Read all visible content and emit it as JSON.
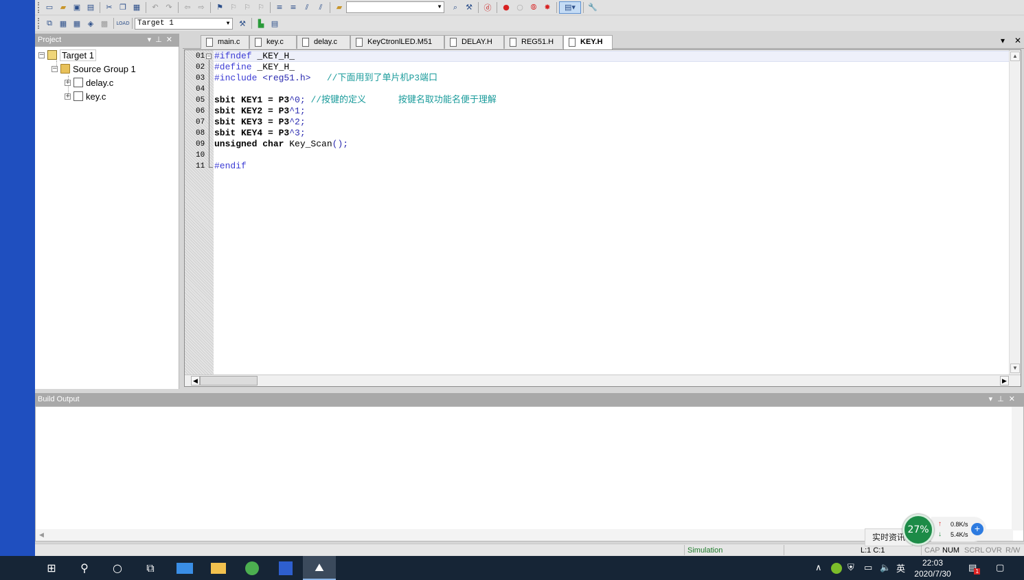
{
  "toolbar": {
    "target_combo": "Target 1",
    "find_combo": ""
  },
  "project": {
    "title": "Project",
    "target": "Target 1",
    "group": "Source Group 1",
    "files": [
      "delay.c",
      "key.c"
    ]
  },
  "tabs": [
    "main.c",
    "key.c",
    "delay.c",
    "KeyCtronlLED.M51",
    "DELAY.H",
    "REG51.H",
    "KEY.H"
  ],
  "active_tab": "KEY.H",
  "code": {
    "line_numbers": [
      "01",
      "02",
      "03",
      "04",
      "05",
      "06",
      "07",
      "08",
      "09",
      "10",
      "11"
    ],
    "l1_pre": "#ifndef",
    "l1_rest": " _KEY_H_",
    "l2_pre": "#define",
    "l2_rest": " _KEY_H_",
    "l3_pre": "#include",
    "l3_str": " <reg51.h>",
    "l3_cmt": "   //下面用到了单片机P3端口",
    "l5_a": "sbit KEY1 = P3",
    "l5_b": "^0",
    "l5_c": ";",
    "l5_cmt": " //按键的定义      按键名取功能名便于理解",
    "l6_a": "sbit KEY2 = P3",
    "l6_b": "^1",
    "l6_c": ";",
    "l7_a": "sbit KEY3 = P3",
    "l7_b": "^2",
    "l7_c": ";",
    "l8_a": "sbit KEY4 = P3",
    "l8_b": "^3",
    "l8_c": ";",
    "l9_kw": "unsigned char",
    "l9_rest": " Key_Scan",
    "l9_end": "();",
    "l11_pre": "#endif"
  },
  "build": {
    "title": "Build Output"
  },
  "status": {
    "mode": "Simulation",
    "position": "L:1 C:1",
    "caps": "CAP",
    "num": "NUM",
    "scrl": "SCRL",
    "ovr": "OVR",
    "rw": "R/W"
  },
  "monitor": {
    "label": "实时资讯",
    "percent": "27%",
    "upload": "0.8K/s",
    "download": "5.4K/s"
  },
  "taskbar": {
    "ime": "英",
    "time": "22:03",
    "date": "2020/7/30",
    "notif_count": "1"
  },
  "colors": {
    "preprocessor": "#3a3ad4",
    "comment": "#1a9b9b",
    "panel_header": "#a9a9a9",
    "taskbar": "#162536"
  }
}
